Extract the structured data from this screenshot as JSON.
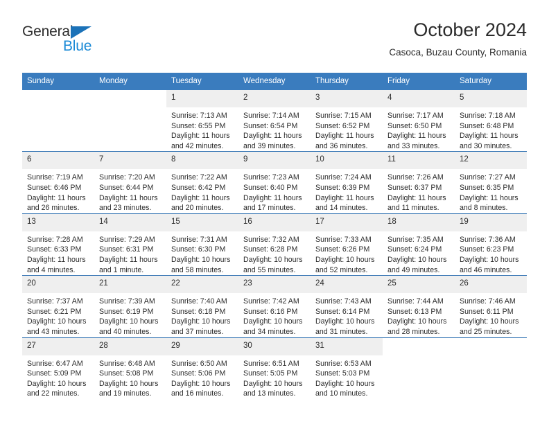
{
  "brand": {
    "name_top": "General",
    "name_bottom": "Blue",
    "triangle_color": "#1b72b8",
    "blue_color": "#1b8ad6"
  },
  "header": {
    "title": "October 2024",
    "subtitle": "Casoca, Buzau County, Romania"
  },
  "theme": {
    "header_bg": "#3a7cbe",
    "header_text": "#ffffff",
    "daynum_bg": "#efefef",
    "row_divider": "#2a6db0"
  },
  "weekday_headers": [
    "Sunday",
    "Monday",
    "Tuesday",
    "Wednesday",
    "Thursday",
    "Friday",
    "Saturday"
  ],
  "weeks": [
    [
      {
        "day": ""
      },
      {
        "day": ""
      },
      {
        "day": "1",
        "sunrise": "Sunrise: 7:13 AM",
        "sunset": "Sunset: 6:55 PM",
        "daylight1": "Daylight: 11 hours",
        "daylight2": "and 42 minutes."
      },
      {
        "day": "2",
        "sunrise": "Sunrise: 7:14 AM",
        "sunset": "Sunset: 6:54 PM",
        "daylight1": "Daylight: 11 hours",
        "daylight2": "and 39 minutes."
      },
      {
        "day": "3",
        "sunrise": "Sunrise: 7:15 AM",
        "sunset": "Sunset: 6:52 PM",
        "daylight1": "Daylight: 11 hours",
        "daylight2": "and 36 minutes."
      },
      {
        "day": "4",
        "sunrise": "Sunrise: 7:17 AM",
        "sunset": "Sunset: 6:50 PM",
        "daylight1": "Daylight: 11 hours",
        "daylight2": "and 33 minutes."
      },
      {
        "day": "5",
        "sunrise": "Sunrise: 7:18 AM",
        "sunset": "Sunset: 6:48 PM",
        "daylight1": "Daylight: 11 hours",
        "daylight2": "and 30 minutes."
      }
    ],
    [
      {
        "day": "6",
        "sunrise": "Sunrise: 7:19 AM",
        "sunset": "Sunset: 6:46 PM",
        "daylight1": "Daylight: 11 hours",
        "daylight2": "and 26 minutes."
      },
      {
        "day": "7",
        "sunrise": "Sunrise: 7:20 AM",
        "sunset": "Sunset: 6:44 PM",
        "daylight1": "Daylight: 11 hours",
        "daylight2": "and 23 minutes."
      },
      {
        "day": "8",
        "sunrise": "Sunrise: 7:22 AM",
        "sunset": "Sunset: 6:42 PM",
        "daylight1": "Daylight: 11 hours",
        "daylight2": "and 20 minutes."
      },
      {
        "day": "9",
        "sunrise": "Sunrise: 7:23 AM",
        "sunset": "Sunset: 6:40 PM",
        "daylight1": "Daylight: 11 hours",
        "daylight2": "and 17 minutes."
      },
      {
        "day": "10",
        "sunrise": "Sunrise: 7:24 AM",
        "sunset": "Sunset: 6:39 PM",
        "daylight1": "Daylight: 11 hours",
        "daylight2": "and 14 minutes."
      },
      {
        "day": "11",
        "sunrise": "Sunrise: 7:26 AM",
        "sunset": "Sunset: 6:37 PM",
        "daylight1": "Daylight: 11 hours",
        "daylight2": "and 11 minutes."
      },
      {
        "day": "12",
        "sunrise": "Sunrise: 7:27 AM",
        "sunset": "Sunset: 6:35 PM",
        "daylight1": "Daylight: 11 hours",
        "daylight2": "and 8 minutes."
      }
    ],
    [
      {
        "day": "13",
        "sunrise": "Sunrise: 7:28 AM",
        "sunset": "Sunset: 6:33 PM",
        "daylight1": "Daylight: 11 hours",
        "daylight2": "and 4 minutes."
      },
      {
        "day": "14",
        "sunrise": "Sunrise: 7:29 AM",
        "sunset": "Sunset: 6:31 PM",
        "daylight1": "Daylight: 11 hours",
        "daylight2": "and 1 minute."
      },
      {
        "day": "15",
        "sunrise": "Sunrise: 7:31 AM",
        "sunset": "Sunset: 6:30 PM",
        "daylight1": "Daylight: 10 hours",
        "daylight2": "and 58 minutes."
      },
      {
        "day": "16",
        "sunrise": "Sunrise: 7:32 AM",
        "sunset": "Sunset: 6:28 PM",
        "daylight1": "Daylight: 10 hours",
        "daylight2": "and 55 minutes."
      },
      {
        "day": "17",
        "sunrise": "Sunrise: 7:33 AM",
        "sunset": "Sunset: 6:26 PM",
        "daylight1": "Daylight: 10 hours",
        "daylight2": "and 52 minutes."
      },
      {
        "day": "18",
        "sunrise": "Sunrise: 7:35 AM",
        "sunset": "Sunset: 6:24 PM",
        "daylight1": "Daylight: 10 hours",
        "daylight2": "and 49 minutes."
      },
      {
        "day": "19",
        "sunrise": "Sunrise: 7:36 AM",
        "sunset": "Sunset: 6:23 PM",
        "daylight1": "Daylight: 10 hours",
        "daylight2": "and 46 minutes."
      }
    ],
    [
      {
        "day": "20",
        "sunrise": "Sunrise: 7:37 AM",
        "sunset": "Sunset: 6:21 PM",
        "daylight1": "Daylight: 10 hours",
        "daylight2": "and 43 minutes."
      },
      {
        "day": "21",
        "sunrise": "Sunrise: 7:39 AM",
        "sunset": "Sunset: 6:19 PM",
        "daylight1": "Daylight: 10 hours",
        "daylight2": "and 40 minutes."
      },
      {
        "day": "22",
        "sunrise": "Sunrise: 7:40 AM",
        "sunset": "Sunset: 6:18 PM",
        "daylight1": "Daylight: 10 hours",
        "daylight2": "and 37 minutes."
      },
      {
        "day": "23",
        "sunrise": "Sunrise: 7:42 AM",
        "sunset": "Sunset: 6:16 PM",
        "daylight1": "Daylight: 10 hours",
        "daylight2": "and 34 minutes."
      },
      {
        "day": "24",
        "sunrise": "Sunrise: 7:43 AM",
        "sunset": "Sunset: 6:14 PM",
        "daylight1": "Daylight: 10 hours",
        "daylight2": "and 31 minutes."
      },
      {
        "day": "25",
        "sunrise": "Sunrise: 7:44 AM",
        "sunset": "Sunset: 6:13 PM",
        "daylight1": "Daylight: 10 hours",
        "daylight2": "and 28 minutes."
      },
      {
        "day": "26",
        "sunrise": "Sunrise: 7:46 AM",
        "sunset": "Sunset: 6:11 PM",
        "daylight1": "Daylight: 10 hours",
        "daylight2": "and 25 minutes."
      }
    ],
    [
      {
        "day": "27",
        "sunrise": "Sunrise: 6:47 AM",
        "sunset": "Sunset: 5:09 PM",
        "daylight1": "Daylight: 10 hours",
        "daylight2": "and 22 minutes."
      },
      {
        "day": "28",
        "sunrise": "Sunrise: 6:48 AM",
        "sunset": "Sunset: 5:08 PM",
        "daylight1": "Daylight: 10 hours",
        "daylight2": "and 19 minutes."
      },
      {
        "day": "29",
        "sunrise": "Sunrise: 6:50 AM",
        "sunset": "Sunset: 5:06 PM",
        "daylight1": "Daylight: 10 hours",
        "daylight2": "and 16 minutes."
      },
      {
        "day": "30",
        "sunrise": "Sunrise: 6:51 AM",
        "sunset": "Sunset: 5:05 PM",
        "daylight1": "Daylight: 10 hours",
        "daylight2": "and 13 minutes."
      },
      {
        "day": "31",
        "sunrise": "Sunrise: 6:53 AM",
        "sunset": "Sunset: 5:03 PM",
        "daylight1": "Daylight: 10 hours",
        "daylight2": "and 10 minutes."
      },
      {
        "day": ""
      },
      {
        "day": ""
      }
    ]
  ]
}
